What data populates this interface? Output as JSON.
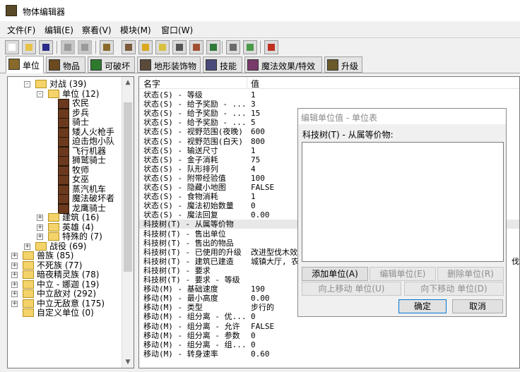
{
  "window": {
    "title": "物体编辑器"
  },
  "menu": [
    "文件(F)",
    "编辑(E)",
    "察看(V)",
    "模块(M)",
    "窗口(W)"
  ],
  "toolbar_icons": [
    {
      "name": "new-file-icon",
      "enabled": true,
      "color": "#ffffff"
    },
    {
      "name": "open-folder-icon",
      "enabled": true,
      "color": "#e7c24a"
    },
    {
      "name": "save-icon",
      "enabled": true,
      "color": "#2b2b8a"
    },
    {
      "name": "copy-icon",
      "enabled": false,
      "color": "#9a9a9a"
    },
    {
      "name": "paste-icon",
      "enabled": false,
      "color": "#9a9a9a"
    },
    {
      "name": "unit-editor-icon",
      "enabled": true,
      "color": "#8a6a2a"
    },
    {
      "name": "terrain-editor-icon",
      "enabled": true,
      "color": "#7a5a3a"
    },
    {
      "name": "text-a-icon",
      "enabled": true,
      "color": "#d9a81e"
    },
    {
      "name": "sound-icon",
      "enabled": true,
      "color": "#d8c040"
    },
    {
      "name": "object-editor-icon",
      "enabled": true,
      "color": "#555555"
    },
    {
      "name": "trigger-editor-icon",
      "enabled": true,
      "color": "#a05030"
    },
    {
      "name": "ai-editor-icon",
      "enabled": true,
      "color": "#2e7a3a"
    },
    {
      "name": "campaign-editor-icon",
      "enabled": true,
      "color": "#6a6a6a"
    },
    {
      "name": "import-icon",
      "enabled": true,
      "color": "#4a9a4a"
    },
    {
      "name": "export-icon",
      "enabled": true,
      "color": "#c03020"
    }
  ],
  "tabs": [
    {
      "label": "单位",
      "active": true,
      "color": "#8a6a2a"
    },
    {
      "label": "物品",
      "active": false,
      "color": "#6b4a20"
    },
    {
      "label": "可破坏",
      "active": false,
      "color": "#2e7a2e"
    },
    {
      "label": "地形装饰物",
      "active": false,
      "color": "#5a4a3a"
    },
    {
      "label": "技能",
      "active": false,
      "color": "#4a4a7a"
    },
    {
      "label": "魔法效果/特效",
      "active": false,
      "color": "#7a3a6a"
    },
    {
      "label": "升级",
      "active": false,
      "color": "#6a5a2a"
    }
  ],
  "tree": [
    {
      "depth": 1,
      "expander": "-",
      "icon": "folder",
      "label": "对战 (39)"
    },
    {
      "depth": 2,
      "expander": "-",
      "icon": "folder",
      "label": "单位 (12)"
    },
    {
      "depth": 3,
      "expander": "",
      "icon": "unit",
      "label": "农民"
    },
    {
      "depth": 3,
      "expander": "",
      "icon": "unit",
      "label": "步兵"
    },
    {
      "depth": 3,
      "expander": "",
      "icon": "unit",
      "label": "骑士"
    },
    {
      "depth": 3,
      "expander": "",
      "icon": "unit",
      "label": "矮人火枪手"
    },
    {
      "depth": 3,
      "expander": "",
      "icon": "unit",
      "label": "迫击炮小队"
    },
    {
      "depth": 3,
      "expander": "",
      "icon": "unit",
      "label": "飞行机器"
    },
    {
      "depth": 3,
      "expander": "",
      "icon": "unit",
      "label": "狮鹫骑士"
    },
    {
      "depth": 3,
      "expander": "",
      "icon": "unit",
      "label": "牧师"
    },
    {
      "depth": 3,
      "expander": "",
      "icon": "unit",
      "label": "女巫"
    },
    {
      "depth": 3,
      "expander": "",
      "icon": "unit",
      "label": "蒸汽机车"
    },
    {
      "depth": 3,
      "expander": "",
      "icon": "unit",
      "label": "魔法破坏者"
    },
    {
      "depth": 3,
      "expander": "",
      "icon": "unit",
      "label": "龙鹰骑士"
    },
    {
      "depth": 2,
      "expander": "+",
      "icon": "folder",
      "label": "建筑 (16)"
    },
    {
      "depth": 2,
      "expander": "+",
      "icon": "folder",
      "label": "英雄 (4)"
    },
    {
      "depth": 2,
      "expander": "+",
      "icon": "folder",
      "label": "特殊的 (7)"
    },
    {
      "depth": 1,
      "expander": "+",
      "icon": "folder",
      "label": "战役 (69)"
    },
    {
      "depth": 0,
      "expander": "+",
      "icon": "folder",
      "label": "兽族 (85)"
    },
    {
      "depth": 0,
      "expander": "+",
      "icon": "folder",
      "label": "不死族 (77)"
    },
    {
      "depth": 0,
      "expander": "+",
      "icon": "folder",
      "label": "暗夜精灵族 (78)"
    },
    {
      "depth": 0,
      "expander": "+",
      "icon": "folder",
      "label": "中立 - 娜迦 (19)"
    },
    {
      "depth": 0,
      "expander": "+",
      "icon": "folder",
      "label": "中立敌对 (292)"
    },
    {
      "depth": 0,
      "expander": "+",
      "icon": "folder",
      "label": "中立无敌意 (175)"
    },
    {
      "depth": 0,
      "expander": "",
      "icon": "folder",
      "label": "自定义单位 (0)"
    }
  ],
  "grid": {
    "headers": [
      "名字",
      "值"
    ],
    "rows": [
      {
        "name": "状态(S) - 等级",
        "value": "1"
      },
      {
        "name": "状态(S) - 给予奖励 - ...",
        "value": "3"
      },
      {
        "name": "状态(S) - 给予奖励 - ...",
        "value": "15"
      },
      {
        "name": "状态(S) - 给予奖励 - ...",
        "value": "5"
      },
      {
        "name": "状态(S) - 视野范围(夜晚)",
        "value": "600"
      },
      {
        "name": "状态(S) - 视野范围(白天)",
        "value": "800"
      },
      {
        "name": "状态(S) - 输送尺寸",
        "value": "1"
      },
      {
        "name": "状态(S) - 金子消耗",
        "value": "75"
      },
      {
        "name": "状态(S) - 队形排列",
        "value": "4"
      },
      {
        "name": "状态(S) - 附带经验值",
        "value": "100"
      },
      {
        "name": "状态(S) - 隐藏小地图",
        "value": "FALSE"
      },
      {
        "name": "状态(S) - 食物消耗",
        "value": "1"
      },
      {
        "name": "状态(S) - 魔法初始数量",
        "value": "0"
      },
      {
        "name": "状态(S) - 魔法回复",
        "value": "0.00"
      },
      {
        "name": "科技树(T) - 从属等价物",
        "value": ""
      },
      {
        "name": "科技树(T) - 售出单位",
        "value": ""
      },
      {
        "name": "科技树(T) - 售出的物品",
        "value": ""
      },
      {
        "name": "科技树(T) - 已使用的升级",
        "value": "改进型伐木效"
      },
      {
        "name": "科技树(T) - 建筑已建造",
        "value": "城镇大厅, 农"
      },
      {
        "name": "科技树(T) - 要求",
        "value": ""
      },
      {
        "name": "科技树(T) - 要求 - 等级",
        "value": ""
      },
      {
        "name": "移动(M) - 基础速度",
        "value": "190"
      },
      {
        "name": "移动(M) - 最小高度",
        "value": "0.00"
      },
      {
        "name": "移动(M) - 类型",
        "value": "步行的"
      },
      {
        "name": "移动(M) - 组分离 - 优...",
        "value": "0"
      },
      {
        "name": "移动(M) - 组分离 - 允许",
        "value": "FALSE"
      },
      {
        "name": "移动(M) - 组分离 - 参数",
        "value": "0"
      },
      {
        "name": "移动(M) - 组分离 - 组...",
        "value": "0"
      },
      {
        "name": "移动(M) - 转身速率",
        "value": "0.60"
      }
    ],
    "selected_row": 14,
    "overflow_text": "，伐"
  },
  "dialog": {
    "title": "编辑单位值 - 单位表",
    "field_label": "科技树(T) - 从属等价物:",
    "buttons": {
      "add": "添加单位(A)",
      "edit": "编辑单位(E)",
      "delete": "删除单位(R)",
      "move_up": "向上移动 单位(U)",
      "move_down": "向下移动 单位(D)",
      "ok": "确定",
      "cancel": "取消"
    }
  }
}
